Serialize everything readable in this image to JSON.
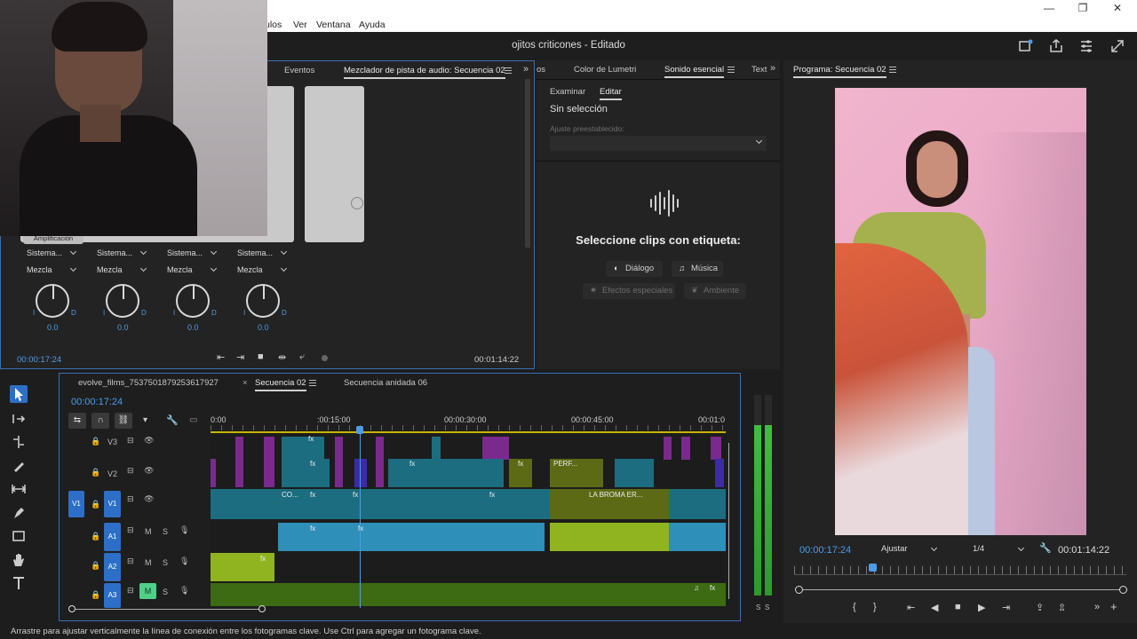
{
  "menu": {
    "items": [
      "ulos",
      "Ver",
      "Ventana",
      "Ayuda"
    ]
  },
  "app": {
    "title": "ojitos criticones - Editado"
  },
  "audio_mixer": {
    "tabs": [
      "Eventos",
      "Mezclador de pista de audio: Secuencia 02"
    ],
    "amp_label": "Amplificación",
    "routing": [
      "Sistema...",
      "Sistema...",
      "Sistema...",
      "Sistema..."
    ],
    "mode": [
      "Mezcla",
      "Mezcla",
      "Mezcla",
      "Mezcla"
    ],
    "knob_left": "I",
    "knob_right": "D",
    "values": [
      "0.0",
      "0.0",
      "0.0",
      "0.0"
    ],
    "timecode_left": "00:00:17:24",
    "timecode_right": "00:01:14:22"
  },
  "essential": {
    "tabs": [
      "os",
      "Color de Lumetri",
      "Sonido esencial",
      "Text"
    ],
    "subtabs": [
      "Examinar",
      "Editar"
    ],
    "no_selection": "Sin selección",
    "preset_label": "Ajuste preestablecido:",
    "prompt": "Seleccione clips con etiqueta:",
    "chips": [
      "Diálogo",
      "Música",
      "Efectos especiales",
      "Ambiente"
    ]
  },
  "program": {
    "tab": "Programa: Secuencia 02",
    "timecode": "00:00:17:24",
    "fit": "Ajustar",
    "quality": "1/4",
    "duration": "00:01:14:22",
    "btn_mark_in": "{",
    "btn_mark_out": "}"
  },
  "timeline": {
    "tabs": [
      "evolve_films_7537501879253617927",
      "Secuencia 02",
      "Secuencia anidada 06"
    ],
    "close_mark": "×",
    "timecode": "00:00:17:24",
    "ruler": [
      "0:00",
      ":00:15:00",
      "00:00:30:00",
      "00:00:45:00",
      "00:01:0"
    ],
    "tracks": [
      {
        "id": "V3",
        "src": ""
      },
      {
        "id": "V2",
        "src": ""
      },
      {
        "id": "V1",
        "src": "V1"
      },
      {
        "id": "A1",
        "src": ""
      },
      {
        "id": "A2",
        "src": ""
      },
      {
        "id": "A3",
        "src": ""
      }
    ],
    "mute": "M",
    "solo": "S",
    "clip_labels": {
      "fx": "fx",
      "c0": "CO...",
      "perf": "PERF...",
      "broma": "LA BROMA ER...",
      "music_note": "♫"
    }
  },
  "meter": {
    "labels": [
      "S",
      "S"
    ]
  },
  "status": {
    "text": "Arrastre para ajustar verticalmente la línea de conexión entre los fotogramas clave. Use Ctrl para agregar un fotograma clave."
  },
  "colors": {
    "accent": "#4d9de6",
    "video_clip": "#1c6d80",
    "purple_clip": "#7a2a8c",
    "audio_clip": "#2e8fb8",
    "green_audio": "#6f8f1a"
  }
}
